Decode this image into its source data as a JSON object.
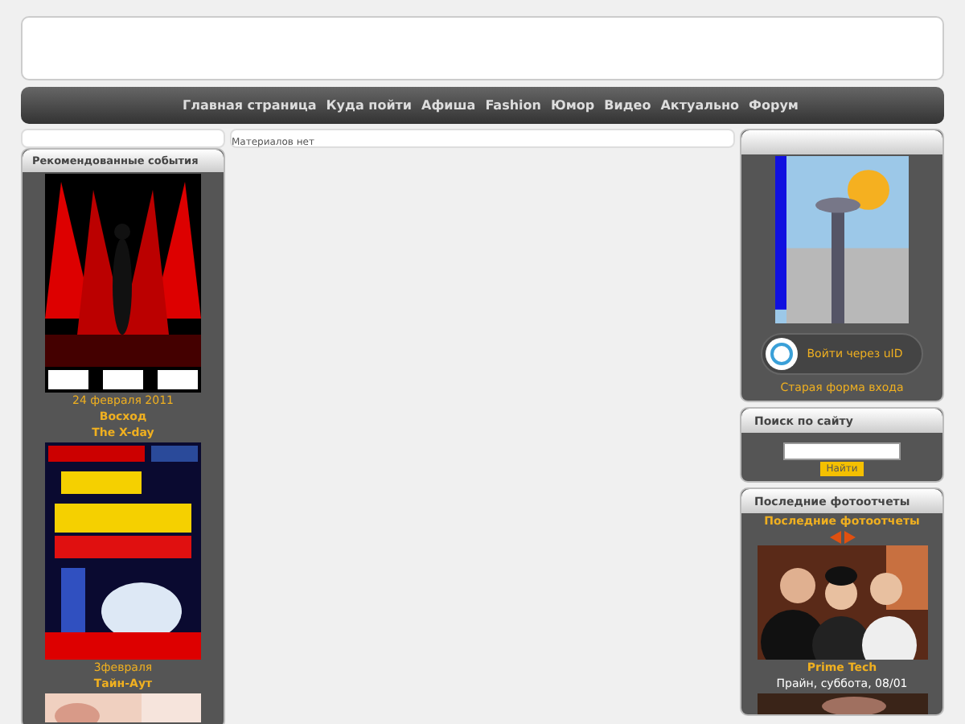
{
  "nav": {
    "items": [
      "Главная страница",
      "Куда пойти",
      "Афиша",
      "Fashion",
      "Юмор",
      "Видео",
      "Актуально",
      "Форум"
    ]
  },
  "content": {
    "message": "Материалов нет"
  },
  "events": {
    "title": "Рекомендованные события",
    "items": [
      {
        "kind": "party",
        "date": "24 февраля 2011",
        "place": "Восход",
        "name": "The X-day"
      },
      {
        "kind": "poster",
        "date": "3февраля",
        "place": "Тайн-Аут"
      },
      {
        "kind": "skin"
      }
    ]
  },
  "login": {
    "button": "Войти через uID",
    "link": "Старая форма входа"
  },
  "search": {
    "title": "Поиск по сайту",
    "button": "Найти"
  },
  "photos": {
    "title": "Последние фотоотчеты",
    "subtitle": "Последние фотоотчеты",
    "items": [
      {
        "kind": "crowd",
        "name": "Prime Tech",
        "caption": "Прайн, суббота, 08/01"
      },
      {
        "kind": "dark"
      }
    ]
  }
}
